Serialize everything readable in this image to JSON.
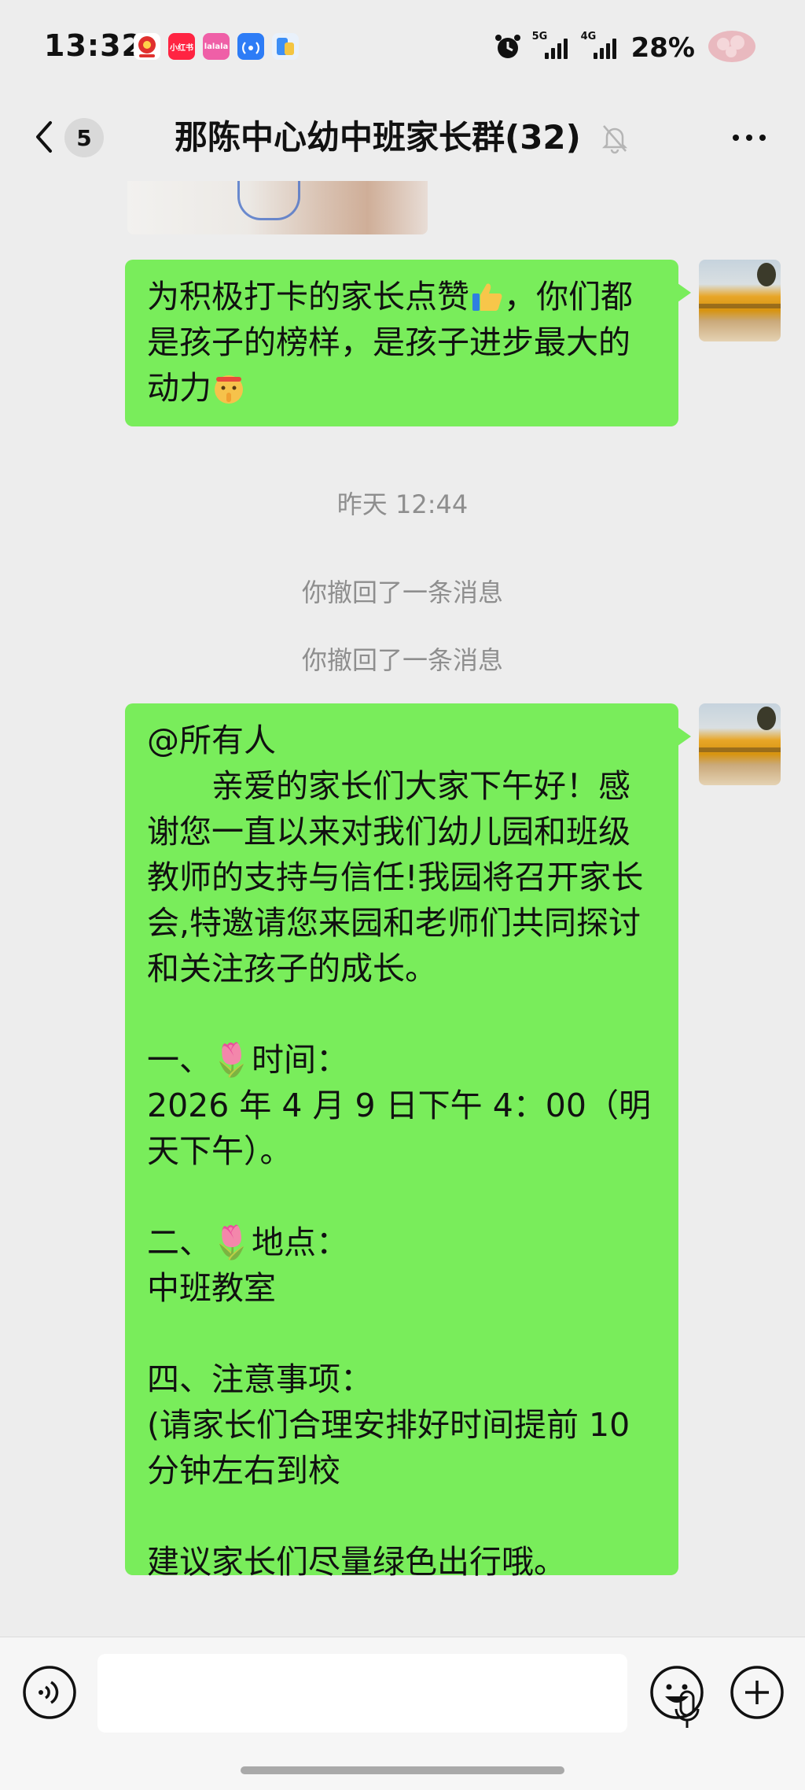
{
  "status_bar": {
    "time": "13:32",
    "battery": "28%",
    "network_1": "5G",
    "network_2": "4G",
    "apps": [
      "小红书",
      "lalala"
    ]
  },
  "nav": {
    "unread_count": "5",
    "title": "那陈中心幼中班家长群(32)",
    "icons": [
      "back-arrow-icon",
      "mute-bell-icon",
      "more-icon"
    ]
  },
  "messages": [
    {
      "type": "image",
      "sender": "self"
    },
    {
      "type": "text",
      "sender": "self",
      "text_before": "为积极打卡的家长点赞",
      "emoji_1": "thumbs-up",
      "text_after": "，你们都是孩子的榜样，是孩子进步最大的动力",
      "emoji_2": "shushing-face"
    },
    {
      "type": "time",
      "text": "昨天 12:44"
    },
    {
      "type": "system",
      "text": "你撤回了一条消息"
    },
    {
      "type": "system",
      "text": "你撤回了一条消息"
    },
    {
      "type": "text",
      "sender": "self",
      "lines": [
        "@所有人",
        "　　亲爱的家长们大家下午好！感谢您一直以来对我们幼儿园和班级教师的支持与信任!我园将召开家长会,特邀请您来园和老师们共同探讨和关注孩子的成长。",
        "",
        "一、🌷时间：",
        "2026 年 4 月 9 日下午 4：00（明天下午）。",
        "",
        "二、🌷地点：",
        "中班教室",
        "",
        "四、注意事项：",
        "(请家长们合理安排好时间提前 10 分钟左右到校",
        "",
        "建议家长们尽量绿色出行哦。"
      ]
    }
  ],
  "input_bar": {
    "placeholder": "",
    "icons": [
      "voice-icon",
      "mic-icon",
      "emoji-icon",
      "plus-icon"
    ]
  },
  "colors": {
    "background": "#ededed",
    "bubble_self": "#79ed5b",
    "system_text": "#8e8e8e"
  }
}
